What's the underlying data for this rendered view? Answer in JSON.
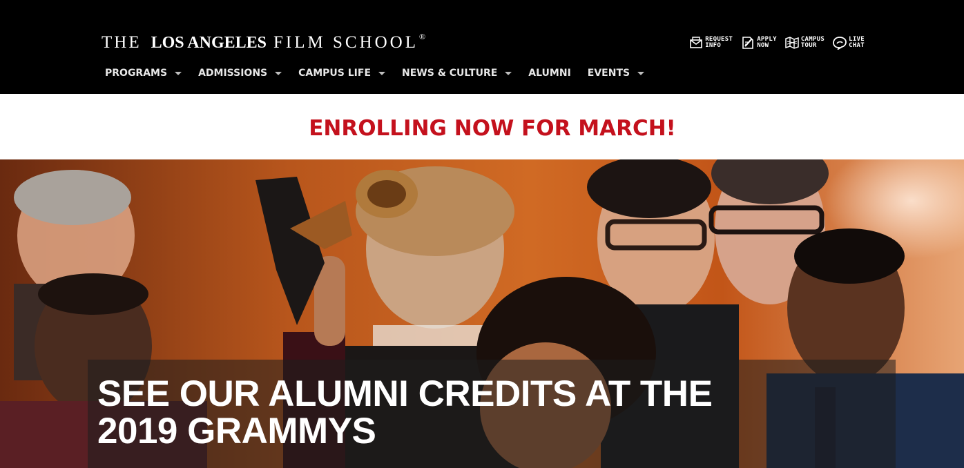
{
  "header": {
    "logo": {
      "the": "THE",
      "name": "LOS ANGELES",
      "film_school": "FILM SCHOOL",
      "reg": "®"
    },
    "utility_links": [
      {
        "line1": "REQUEST",
        "line2": "INFO",
        "icon": "envelope-icon"
      },
      {
        "line1": "APPLY",
        "line2": "NOW",
        "icon": "pencil-form-icon"
      },
      {
        "line1": "CAMPUS",
        "line2": "TOUR",
        "icon": "map-fold-icon"
      },
      {
        "line1": "LIVE",
        "line2": "CHAT",
        "icon": "chat-bubble-icon"
      }
    ],
    "nav": [
      {
        "label": "PROGRAMS",
        "dropdown": true
      },
      {
        "label": "ADMISSIONS",
        "dropdown": true
      },
      {
        "label": "CAMPUS LIFE",
        "dropdown": true
      },
      {
        "label": "NEWS & CULTURE",
        "dropdown": true
      },
      {
        "label": "ALUMNI",
        "dropdown": false
      },
      {
        "label": "EVENTS",
        "dropdown": true
      }
    ]
  },
  "banner": {
    "text": "ENROLLING NOW FOR MARCH!",
    "color": "#c4111d"
  },
  "hero": {
    "headline_line1": "SEE OUR ALUMNI CREDITS AT THE",
    "headline_line2": "2019 GRAMMYS"
  },
  "colors": {
    "header_bg": "#000000",
    "banner_text": "#c4111d",
    "hero_bg": "#c25518"
  }
}
